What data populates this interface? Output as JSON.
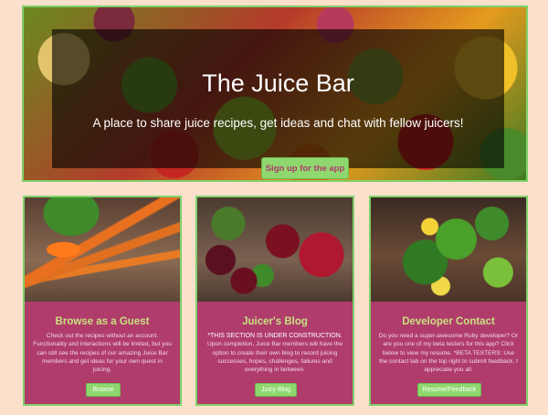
{
  "hero": {
    "title": "The Juice Bar",
    "subtitle": "A place to share juice recipes, get ideas and chat with fellow juicers!",
    "signup_label": "Sign up for the app"
  },
  "cards": [
    {
      "title": "Browse as a Guest",
      "text": "Check out the recipes without an account. Functionality and interactions will be limited, but you can still see the recipes of our amazing Juice Bar members and get ideas for your own quest in juicing.",
      "button": "Browse"
    },
    {
      "title": "Juicer's Blog",
      "notice": "*THIS SECTION IS UNDER CONSTRUCTION.",
      "text": "Upon completion, Juice Bar members will have the option to create their own blog to record juicing successes, hopes, challenges, failures and everything in between.",
      "button": "Juicy Blog"
    },
    {
      "title": "Developer Contact",
      "text": "Do you need a super-awesome Ruby developer? Or are you one of my beta testers for this app? Click below to view my resume. *BETA TESTERS: Use the contact tab on the top right to submit feedback. I appreciate you all.",
      "button": "Resume/Feedback"
    }
  ],
  "colors": {
    "background": "#fde0cc",
    "card": "#b03c6c",
    "accent_green": "#8fd86f",
    "card_title": "#c8e080"
  }
}
